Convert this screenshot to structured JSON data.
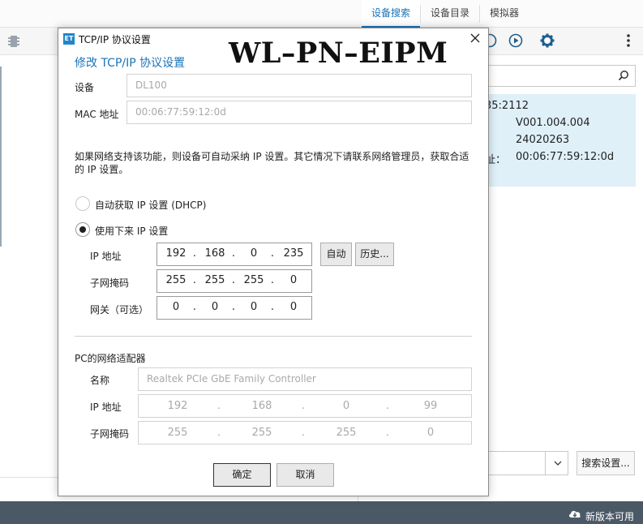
{
  "tabs": [
    {
      "label": "设备搜索",
      "active": true
    },
    {
      "label": "设备目录",
      "active": false
    },
    {
      "label": "模拟器",
      "active": false
    }
  ],
  "device_card": {
    "line1": "35:2112",
    "version": "V001.004.004",
    "serial": "24020263",
    "mac_label": "址：",
    "mac": "00:06:77:59:12:0d"
  },
  "search_settings_label": "搜索设置...",
  "status": {
    "update_label": "新版本可用"
  },
  "dialog": {
    "title": "TCP/IP 协议设置",
    "overlay_title": "WL–PN–EIPM",
    "heading": "修改 TCP/IP 协议设置",
    "device_label": "设备",
    "device_value": "DL100",
    "mac_label": "MAC 地址",
    "mac_value": "00:06:77:59:12:0d",
    "info": "如果网络支持该功能，则设备可自动采纳 IP 设置。其它情况下请联系网络管理员，获取合适的 IP 设置。",
    "radio_dhcp": "自动获取 IP 设置 (DHCP)",
    "radio_static": "使用下来 IP 设置",
    "ip_label": "IP 地址",
    "mask_label": "子网掩码",
    "gateway_label": "网关（可选）",
    "ip": [
      "192",
      "168",
      "0",
      "235"
    ],
    "mask": [
      "255",
      "255",
      "255",
      "0"
    ],
    "gateway": [
      "0",
      "0",
      "0",
      "0"
    ],
    "auto_button": "自动",
    "history_button": "历史...",
    "pc_section": "PC的网络适配器",
    "pc_name_label": "名称",
    "pc_name_value": "Realtek PCIe GbE Family Controller",
    "pc_ip_label": "IP 地址",
    "pc_mask_label": "子网掩码",
    "pc_ip": [
      "192",
      "168",
      "0",
      "99"
    ],
    "pc_mask": [
      "255",
      "255",
      "255",
      "0"
    ],
    "ok_button": "确定",
    "cancel_button": "取消"
  },
  "colors": {
    "accent": "#1a73b8",
    "statusbar": "#4b5966",
    "card": "#dff0f9"
  }
}
